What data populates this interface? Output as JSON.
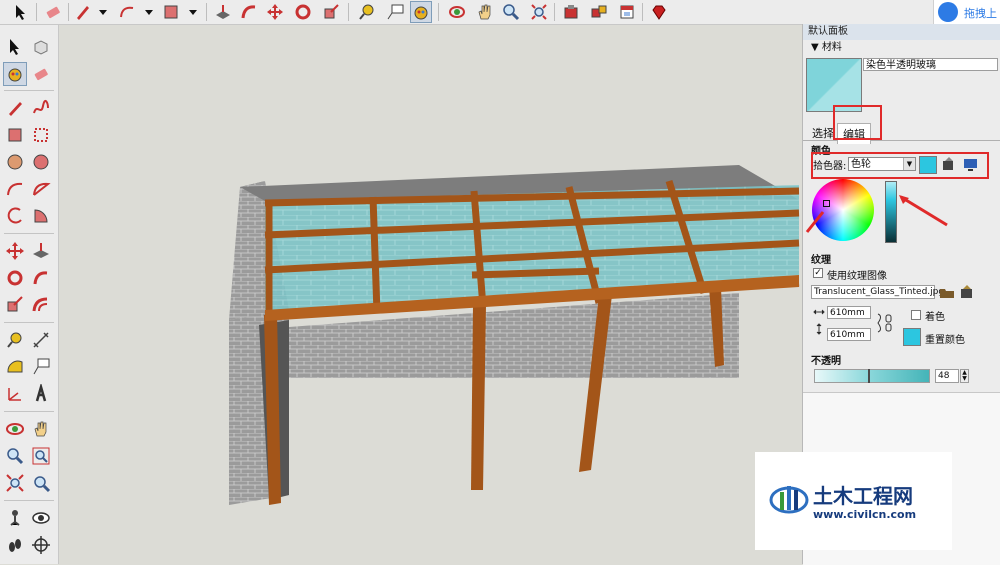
{
  "cloud": {
    "text": "拖拽上"
  },
  "panel": {
    "title": "默认面板",
    "section_header": "▼ 材料",
    "material_name": "染色半透明玻璃",
    "tabs": {
      "select": "选择",
      "edit": "编辑"
    },
    "color_section": "颜色",
    "picker_label": "拾色器:",
    "picker_value": "色轮",
    "texture_section": "纹理",
    "use_texture_label": "使用纹理图像",
    "texture_file": "Translucent_Glass_Tinted.jpg",
    "width_value": "610mm",
    "height_value": "610mm",
    "colorize_label": "着色",
    "reset_color_label": "重置颜色",
    "opacity_section": "不透明",
    "opacity_value": "48",
    "opacity_level": 0.48,
    "color_hex": "#2cc6e0"
  },
  "watermark": {
    "name": "土木工程网",
    "url": "www.civilcn.com"
  }
}
